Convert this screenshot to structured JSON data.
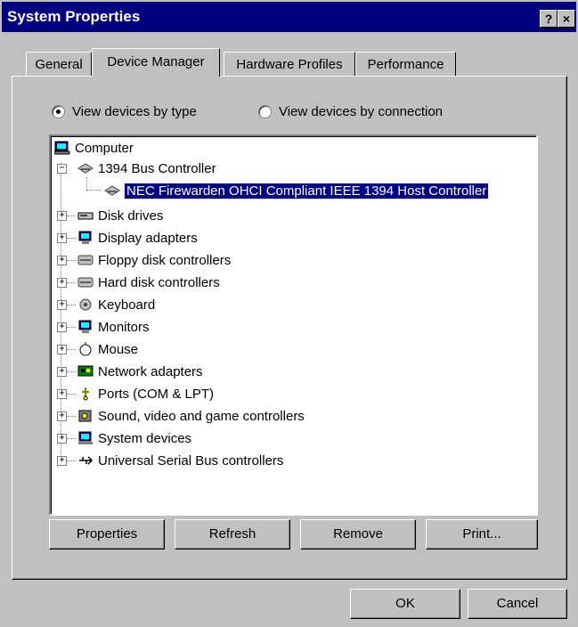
{
  "window": {
    "title": "System Properties",
    "help_glyph": "?",
    "close_glyph": "×"
  },
  "tabs": [
    {
      "label": "General"
    },
    {
      "label": "Device Manager"
    },
    {
      "label": "Hardware Profiles"
    },
    {
      "label": "Performance"
    }
  ],
  "view_options": {
    "by_type": "View devices by type",
    "by_connection": "View devices by connection",
    "selected": "by_type"
  },
  "tree": {
    "root": "Computer",
    "items": [
      {
        "label": "1394 Bus Controller",
        "expanded": true,
        "icon": "controller-icon",
        "children": [
          {
            "label": "NEC Firewarden OHCI Compliant IEEE 1394 Host Controller",
            "selected": true,
            "icon": "controller-icon"
          }
        ]
      },
      {
        "label": "Disk drives",
        "icon": "disk-drive-icon"
      },
      {
        "label": "Display adapters",
        "icon": "display-adapter-icon"
      },
      {
        "label": "Floppy disk controllers",
        "icon": "floppy-controller-icon"
      },
      {
        "label": "Hard disk controllers",
        "icon": "hard-disk-controller-icon"
      },
      {
        "label": "Keyboard",
        "icon": "keyboard-icon"
      },
      {
        "label": "Monitors",
        "icon": "monitor-icon"
      },
      {
        "label": "Mouse",
        "icon": "mouse-icon"
      },
      {
        "label": "Network adapters",
        "icon": "network-adapter-icon"
      },
      {
        "label": "Ports (COM & LPT)",
        "icon": "port-icon"
      },
      {
        "label": "Sound, video and game controllers",
        "icon": "sound-icon"
      },
      {
        "label": "System devices",
        "icon": "system-device-icon"
      },
      {
        "label": "Universal Serial Bus controllers",
        "icon": "usb-icon"
      }
    ]
  },
  "buttons": {
    "properties": "Properties",
    "refresh": "Refresh",
    "remove": "Remove",
    "print": "Print...",
    "ok": "OK",
    "cancel": "Cancel"
  },
  "colors": {
    "titlebar": "#000080",
    "face": "#c0c0c0",
    "selection": "#000080"
  }
}
